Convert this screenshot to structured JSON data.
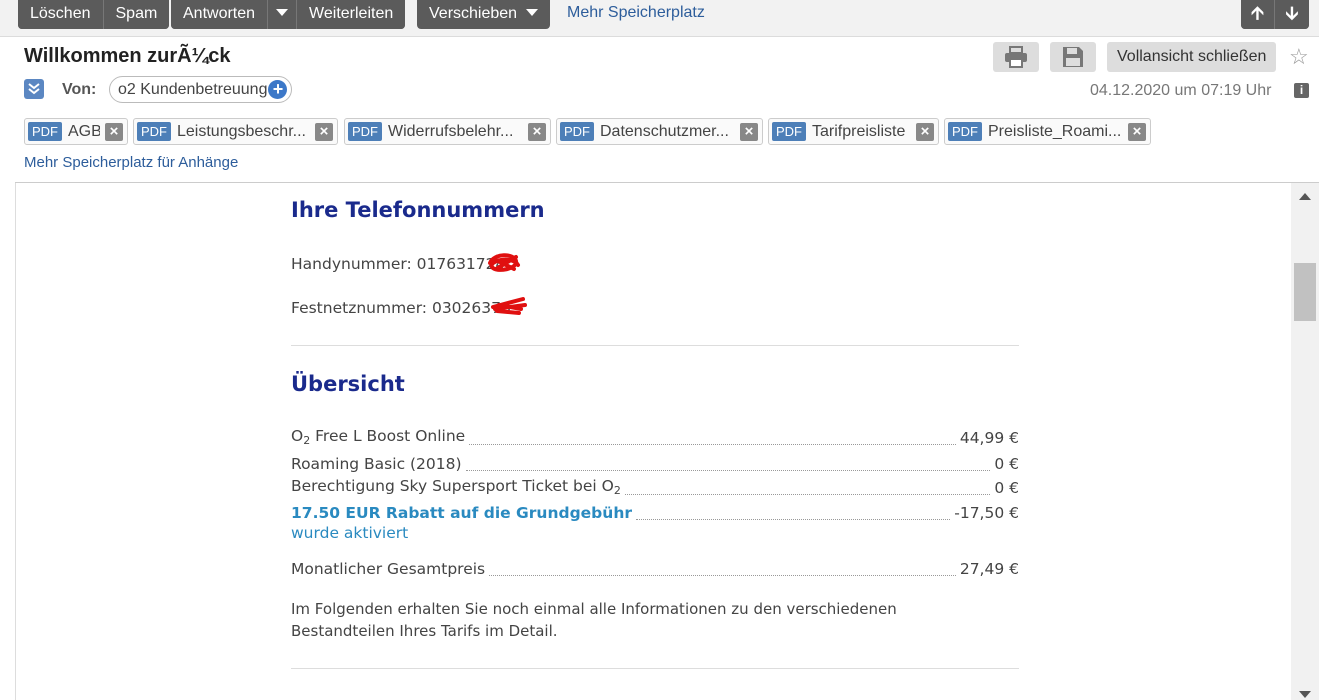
{
  "toolbar": {
    "delete_label": "Löschen",
    "spam_label": "Spam",
    "reply_label": "Antworten",
    "forward_label": "Weiterleiten",
    "move_label": "Verschieben",
    "more_storage_label": "Mehr Speicherplatz"
  },
  "header": {
    "subject": "Willkommen zurÃ¼ck",
    "close_full_view_label": "Vollansicht schließen",
    "from_label": "Von:",
    "sender": "o2 Kundenbetreuung",
    "date": "04.12.2020 um 07:19 Uhr"
  },
  "attachments": [
    {
      "type": "PDF",
      "name": "AGB"
    },
    {
      "type": "PDF",
      "name": "Leistungsbeschr..."
    },
    {
      "type": "PDF",
      "name": "Widerrufsbelehr..."
    },
    {
      "type": "PDF",
      "name": "Datenschutzmer..."
    },
    {
      "type": "PDF",
      "name": "Tarifpreisliste"
    },
    {
      "type": "PDF",
      "name": "Preisliste_Roami..."
    }
  ],
  "attachments_more_storage": "Mehr Speicherplatz für Anhänge",
  "body": {
    "phones_heading": "Ihre Telefonnummern",
    "mobile": "Handynummer: 017631724",
    "landline": "Festnetznummer: 03026376",
    "overview_heading": "Übersicht",
    "rows": [
      {
        "label_main": "O",
        "label_sub": "2",
        "label_rest": " Free L Boost Online",
        "value": "44,99 €"
      },
      {
        "label": "Roaming Basic (2018)",
        "value": "0 €"
      },
      {
        "label_main": "Berechtigung Sky Supersport Ticket bei O",
        "label_sub": "2",
        "value": "0 €"
      },
      {
        "label": "17.50 EUR Rabatt auf die Grundgebühr",
        "value": "-17,50 €",
        "note": "wurde aktiviert"
      },
      {
        "label": "Monatlicher Gesamtpreis",
        "value": "27,49 €"
      }
    ],
    "info_line1": "Im Folgenden erhalten Sie noch einmal alle Informationen zu den verschiedenen",
    "info_line2": "Bestandteilen Ihres Tarifs im Detail."
  },
  "colors": {
    "heading": "#1a2a8c",
    "highlight": "#2a8ac0",
    "toolbar_button": "#5b5b5b",
    "link": "#2d5d9b"
  }
}
